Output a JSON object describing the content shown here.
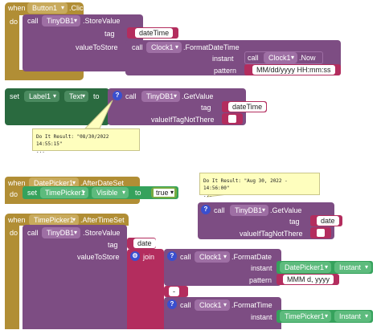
{
  "block1": {
    "when": "when",
    "event_component": "Button1",
    "event_name": ".Click",
    "do": "do",
    "call": "call",
    "component": "TinyDB1",
    "method": ".StoreValue",
    "tag_label": "tag",
    "tag_value": "dateTime",
    "vts_label": "valueToStore",
    "format_call": "call",
    "format_component": "Clock1",
    "format_method": ".FormatDateTime",
    "instant_label": "instant",
    "now_call": "call",
    "now_component": "Clock1",
    "now_method": ".Now",
    "pattern_label": "pattern",
    "pattern_value": "MM/dd/yyyy HH:mm:ss"
  },
  "block2": {
    "set": "set",
    "component": "Label1",
    "property": "Text",
    "to": "to",
    "call": "call",
    "db_component": "TinyDB1",
    "method": ".GetValue",
    "tag_label": "tag",
    "tag_value": "dateTime",
    "default_label": "valueIfTagNotThere",
    "result_title": "Do It Result: \"08/30/2022 14:55:15\"",
    "result_more": "..."
  },
  "block3": {
    "when": "when",
    "event_component": "DatePicker1",
    "event_name": ".AfterDateSet",
    "do": "do",
    "set": "set",
    "component": "TimePicker1",
    "property": "Visible",
    "to": "to",
    "value": "true"
  },
  "block4": {
    "result_title": "Do It Result: \"Aug 30, 2022 - 14:56:00\"",
    "result_more": "...",
    "call": "call",
    "component": "TinyDB1",
    "method": ".GetValue",
    "tag_label": "tag",
    "tag_value": "date",
    "default_label": "valueIfTagNotThere"
  },
  "block5": {
    "when": "when",
    "event_component": "TimePicker1",
    "event_name": ".AfterTimeSet",
    "do": "do",
    "call": "call",
    "component": "TinyDB1",
    "method": ".StoreValue",
    "tag_label": "tag",
    "tag_value": "date",
    "vts_label": "valueToStore",
    "join": "join",
    "fd_call": "call",
    "fd_component": "Clock1",
    "fd_method": ".FormatDate",
    "fd_instant_label": "instant",
    "fd_instant_comp": "DatePicker1",
    "fd_instant_prop": "Instant",
    "fd_pattern_label": "pattern",
    "fd_pattern_value": "MMM d, yyyy",
    "sep_value": " - ",
    "ft_call": "call",
    "ft_component": "Clock1",
    "ft_method": ".FormatTime",
    "ft_instant_label": "instant",
    "ft_instant_comp": "TimePicker1",
    "ft_instant_prop": "Instant"
  },
  "colors": {
    "event": "#b18e35",
    "procedure": "#7d4d83",
    "text": "#b32d5e",
    "label_set": "#2a6a3f",
    "green": "#35a25c",
    "logic": "#77ab41",
    "dropdown": "#9e6fa4",
    "comment": "#fefebe"
  }
}
